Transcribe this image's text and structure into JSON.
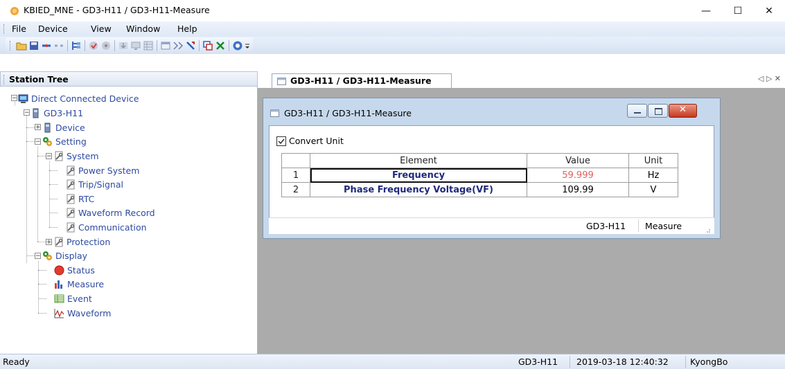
{
  "window": {
    "title": "KBIED_MNE - GD3-H11 / GD3-H11-Measure",
    "minimize": "—",
    "maximize": "☐",
    "close": "✕"
  },
  "menu": [
    "File",
    "Device",
    "View",
    "Window",
    "Help"
  ],
  "station_tree": {
    "title": "Station Tree",
    "nodes": {
      "root": "Direct Connected Device",
      "device": "GD3-H11",
      "device_child": "Device",
      "setting": "Setting",
      "system": "System",
      "power_system": "Power System",
      "trip_signal": "Trip/Signal",
      "rtc": "RTC",
      "waveform_record": "Waveform Record",
      "communication": "Communication",
      "protection": "Protection",
      "display": "Display",
      "status": "Status",
      "measure": "Measure",
      "event": "Event",
      "waveform": "Waveform"
    }
  },
  "mdi": {
    "tab_label": "GD3-H11 / GD3-H11-Measure",
    "tab_nav": "◁ ▷ ✕"
  },
  "child_window": {
    "title": "GD3-H11 / GD3-H11-Measure",
    "checkbox_label": "Convert Unit",
    "checkbox_checked": true,
    "table": {
      "headers": [
        "Element",
        "Value",
        "Unit"
      ],
      "rows": [
        {
          "num": "1",
          "element": "Frequency",
          "value": "59.999",
          "unit": "Hz",
          "value_color": "#e0605a"
        },
        {
          "num": "2",
          "element": "Phase Frequency Voltage(VF)",
          "value": "109.99",
          "unit": "V",
          "value_color": "#000000"
        }
      ]
    },
    "status_device": "GD3-H11",
    "status_view": "Measure"
  },
  "statusbar": {
    "left": "Ready",
    "device": "GD3-H11",
    "datetime": "2019-03-18 12:40:32",
    "user": "KyongBo"
  }
}
